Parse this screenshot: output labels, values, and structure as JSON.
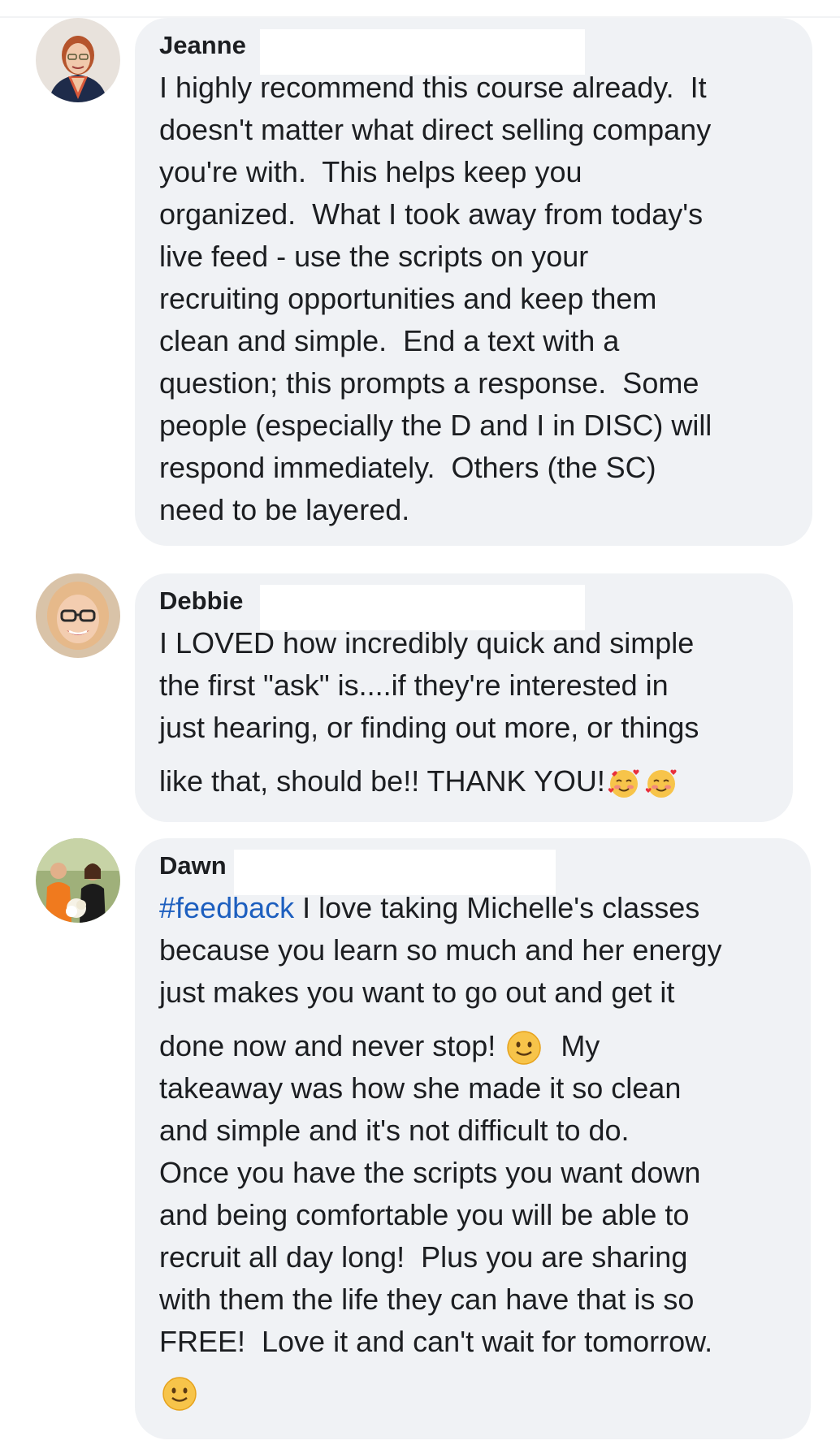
{
  "comments": [
    {
      "author": "Jeanne",
      "lines": [
        "I highly recommend this course already.  It",
        "doesn't matter what direct selling company",
        "you're with.  This helps keep you",
        "organized.  What I took away from today's",
        "live feed - use the scripts on your",
        "recruiting opportunities and keep them",
        "clean and simple.  End a text with a",
        "question; this prompts a response.  Some",
        "people (especially the D and I in DISC) will",
        "respond immediately.  Others (the SC)",
        "need to be layered."
      ]
    },
    {
      "author": "Debbie",
      "lines": [
        "I LOVED how incredibly quick and simple",
        "the first \"ask\" is....if they're interested in",
        "just hearing, or finding out more, or things"
      ],
      "last_line": "like that, should be!! THANK YOU!"
    },
    {
      "author": "Dawn",
      "hashtag": "#feedback",
      "first_line_rest": " I love taking Michelle's classes",
      "lines_a": [
        "because you learn so much and her energy",
        "just makes you want to go out and get it"
      ],
      "emoji_line_before": "done now and never stop! ",
      "emoji_line_after": "  My",
      "lines_b": [
        "takeaway was how she made it so clean",
        "and simple and it's not difficult to do.",
        "Once you have the scripts you want down",
        "and being comfortable you will be able to",
        "recruit all day long!  Plus you are sharing",
        "with them the life they can have that is so",
        "FREE!  Love it and can't wait for tomorrow."
      ]
    }
  ],
  "icons": {
    "smiling_face_with_hearts": "smiling-face-with-hearts-icon",
    "slightly_smiling_face": "slightly-smiling-face-icon"
  },
  "colors": {
    "bubble": "#f0f2f5",
    "hashtag": "#1d5fbf",
    "text": "#1c1e21"
  }
}
